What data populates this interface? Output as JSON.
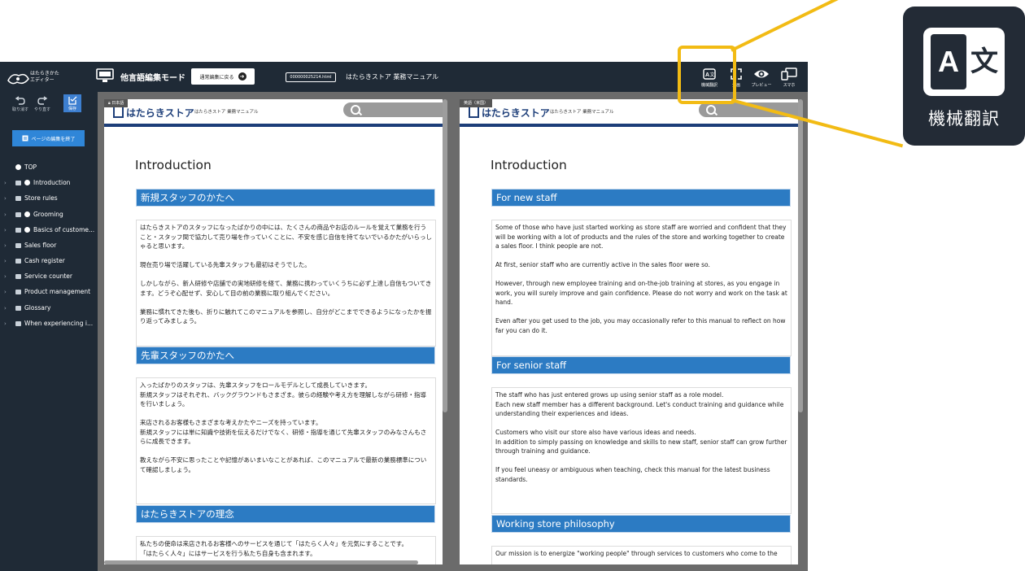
{
  "app": {
    "logo_text_line1": "はたらきかた",
    "logo_text_line2": "エディター",
    "mode_title": "他言語編集モード",
    "back_button": "通常編集に戻る",
    "file_name": "000000025214.html",
    "doc_title": "はたらきストア 業務マニュアル"
  },
  "toolbar": {
    "machine_translate": "機械翻訳",
    "fullscreen": "全画",
    "preview": "プレビュー",
    "smartphone": "スマホ"
  },
  "sidebar": {
    "undo": "取り消す",
    "redo": "やり直す",
    "save": "保存",
    "finish_button": "ページの編集を終了",
    "items": [
      {
        "label": "TOP"
      },
      {
        "label": "Introduction"
      },
      {
        "label": "Store rules"
      },
      {
        "label": "Grooming"
      },
      {
        "label": "Basics of custome..."
      },
      {
        "label": "Sales floor"
      },
      {
        "label": "Cash register"
      },
      {
        "label": "Service counter"
      },
      {
        "label": "Product management"
      },
      {
        "label": "Glossary"
      },
      {
        "label": "When experiencing i..."
      }
    ]
  },
  "left_pane": {
    "lang": "日本語",
    "site_logo": "はたらきストア",
    "site_sub": "はたらきストア 業務マニュアル",
    "heading": "Introduction",
    "sections": [
      {
        "title": "新規スタッフのかたへ",
        "paragraphs": [
          "はたらきストアのスタッフになったばかりの中には、たくさんの商品やお店のルールを覚えて業務を行うこと・スタッフ間で協力して売り場を作っていくことに、不安を感じ自信を持てないでいるかたがいらっしゃると思います。",
          "現在売り場で活躍している先輩スタッフも最初はそうでした。",
          "しかしながら、新人研修や店舗での実地研修を経て、業務に携わっていくうちに必ず上達し自信もついてきます。どうぞ心配せず、安心して目の前の業務に取り組んでください。",
          "業務に慣れてきた後も、折りに触れてこのマニュアルを参照し、自分がどこまでできるようになったかを振り返ってみましょう。"
        ]
      },
      {
        "title": "先輩スタッフのかたへ",
        "paragraphs": [
          "入ったばかりのスタッフは、先輩スタッフをロールモデルとして成長していきます。\n新規スタッフはそれぞれ、バックグラウンドもさまざま。彼らの経験や考え方を理解しながら研修・指導を行いましょう。",
          "来店されるお客様もさまざまな考えかたやニーズを持っています。\n新規スタッフには単に知識や技術を伝えるだけでなく、研修・指導を通じて先輩スタッフのみなさんもさらに成長できます。",
          "教えながら不安に思ったことや記憶があいまいなことがあれば、このマニュアルで最新の業務標準について確認しましょう。"
        ]
      },
      {
        "title": "はたらきストアの理念",
        "paragraphs": [
          "私たちの使命は来店されるお客様へのサービスを通じて「はたらく人々」を元気にすることです。\n「はたらく人々」にはサービスを行う私たち自身も含まれます。"
        ]
      }
    ]
  },
  "right_pane": {
    "lang": "英語（米国）",
    "site_logo": "はたらきストア",
    "site_sub": "はたらきストア 業務マニュアル",
    "heading": "Introduction",
    "sections": [
      {
        "title": "For new staff",
        "paragraphs": [
          "Some of those who have just started working as store staff are worried and confident that they will be working with a lot of products and the rules of the store and working together to create a sales floor. I think people are not.",
          "At first, senior staff who are currently active in the sales floor were so.",
          "However, through new employee training and on-the-job training at stores, as you engage in work, you will surely improve and gain confidence. Please do not worry and work on the task at hand.",
          "Even after you get used to the job, you may occasionally refer to this manual to reflect on how far you can do it."
        ]
      },
      {
        "title": "For senior staff",
        "paragraphs": [
          "The staff who has just entered grows up using senior staff as a role model.\nEach new staff member has a different background. Let's conduct training and guidance while understanding their experiences and ideas.",
          "Customers who visit our store also have various ideas and needs.\nIn addition to simply passing on knowledge and skills to new staff, senior staff can grow further through training and guidance.",
          "If you feel uneasy or ambiguous when teaching, check this manual for the latest business standards."
        ]
      },
      {
        "title": "Working store philosophy",
        "paragraphs": [
          "Our mission is to energize \"working people\" through services to customers who come to the"
        ]
      }
    ]
  },
  "callout": {
    "glyph_a": "A",
    "glyph_bun": "文",
    "label": "機械翻訳"
  },
  "colors": {
    "topbar": "#1f2a36",
    "accent_blue": "#2c7bc3",
    "site_navy": "#1d3e79",
    "highlight": "#f2bb14"
  }
}
